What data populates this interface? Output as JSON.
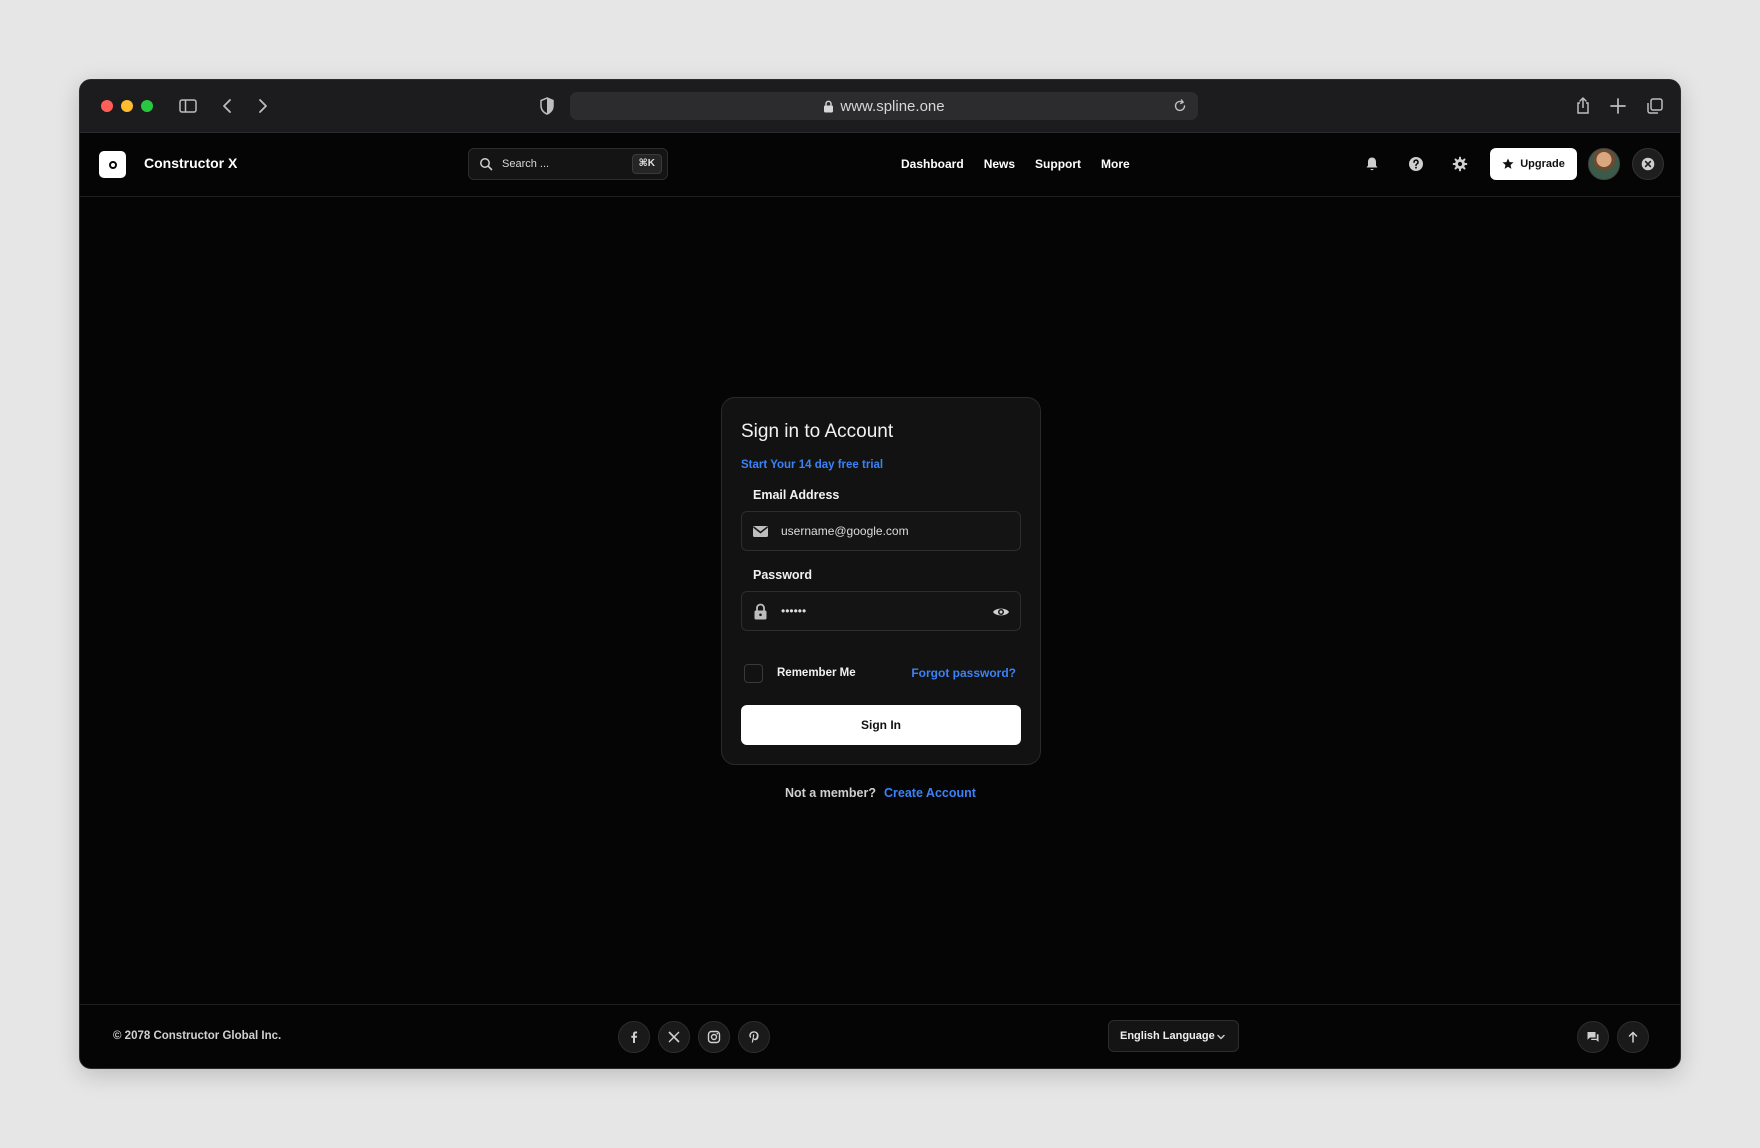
{
  "browser": {
    "url": "www.spline.one"
  },
  "app": {
    "brand": "Constructor X",
    "search": {
      "placeholder": "Search ...",
      "shortcut": "⌘K"
    },
    "nav": [
      "Dashboard",
      "News",
      "Support",
      "More"
    ],
    "upgrade_label": "Upgrade"
  },
  "login": {
    "title": "Sign in to Account",
    "trial_link": "Start Your 14 day free trial",
    "email_label": "Email Address",
    "email_value": "username@google.com",
    "password_label": "Password",
    "password_value": "••••••",
    "remember_label": "Remember Me",
    "remember_checked": false,
    "forgot_link": "Forgot password?",
    "submit_label": "Sign In",
    "not_member": "Not a member?",
    "create_link": "Create Account"
  },
  "footer": {
    "copyright": "© 2078 Constructor Global Inc.",
    "social_icons": [
      "facebook-icon",
      "x-icon",
      "instagram-icon",
      "pinterest-icon"
    ],
    "language": "English Language"
  },
  "colors": {
    "accent": "#3b82f6",
    "background": "#050505",
    "card": "#121212"
  }
}
